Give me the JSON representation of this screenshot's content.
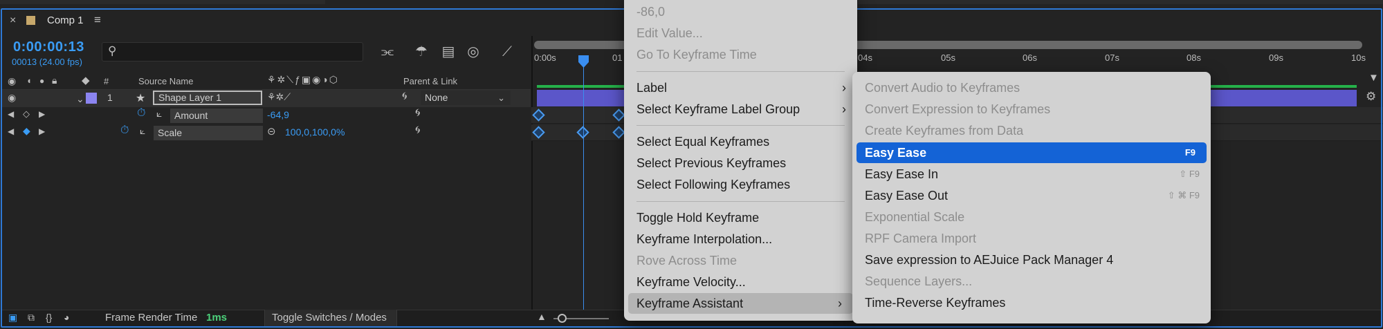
{
  "tab": {
    "title": "Comp 1"
  },
  "comp": {
    "timecode": "0:00:00:13",
    "frames": "00013 (24.00 fps)"
  },
  "columns": {
    "number": "#",
    "source_name": "Source Name",
    "parent_link": "Parent & Link"
  },
  "layer": {
    "index": "1",
    "name": "Shape Layer 1",
    "parent_value": "None",
    "properties": [
      {
        "name": "Amount",
        "value": "-64,9"
      },
      {
        "name": "Scale",
        "value": "100,0,100,0%"
      }
    ]
  },
  "ruler": {
    "ticks": [
      "0:00s",
      "01",
      "04s",
      "05s",
      "06s",
      "07s",
      "08s",
      "09s",
      "10s"
    ]
  },
  "bottom": {
    "frame_render_label": "Frame Render Time",
    "frame_render_value": "1ms",
    "toggle_label": "Toggle Switches / Modes"
  },
  "menu": {
    "items": [
      {
        "label": "-86,0",
        "disabled": true
      },
      {
        "label": "Edit Value...",
        "disabled": true
      },
      {
        "label": "Go To Keyframe Time",
        "disabled": true
      },
      {
        "label": "Label",
        "submenu": true
      },
      {
        "label": "Select Keyframe Label Group",
        "submenu": true
      },
      {
        "label": "Select Equal Keyframes"
      },
      {
        "label": "Select Previous Keyframes"
      },
      {
        "label": "Select Following Keyframes"
      },
      {
        "label": "Toggle Hold Keyframe"
      },
      {
        "label": "Keyframe Interpolation..."
      },
      {
        "label": "Rove Across Time",
        "disabled": true
      },
      {
        "label": "Keyframe Velocity..."
      },
      {
        "label": "Keyframe Assistant",
        "submenu": true
      }
    ]
  },
  "submenu": {
    "items": [
      {
        "label": "Convert Audio to Keyframes",
        "disabled": true
      },
      {
        "label": "Convert Expression to Keyframes",
        "disabled": true
      },
      {
        "label": "Create Keyframes from Data",
        "disabled": true
      },
      {
        "label": "Easy Ease",
        "shortcut": "F9"
      },
      {
        "label": "Easy Ease In",
        "shortcut": "⇧ F9"
      },
      {
        "label": "Easy Ease Out",
        "shortcut": "⇧ ⌘ F9"
      },
      {
        "label": "Exponential Scale",
        "disabled": true
      },
      {
        "label": "RPF Camera Import",
        "disabled": true
      },
      {
        "label": "Save expression to AEJuice Pack Manager 4"
      },
      {
        "label": "Sequence Layers...",
        "disabled": true
      },
      {
        "label": "Time-Reverse Keyframes"
      }
    ]
  },
  "colors": {
    "accent": "#2e79d6",
    "timecode": "#3a9cf5",
    "highlight": "#1463d6",
    "layer_bar": "#5b56c9"
  }
}
